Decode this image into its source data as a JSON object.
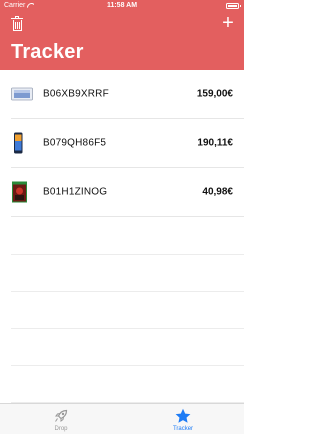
{
  "status_bar": {
    "carrier": "Carrier",
    "time": "11:58 AM"
  },
  "header": {
    "title": "Tracker",
    "add_label": "+"
  },
  "items": [
    {
      "sku": "B06XB9XRRF",
      "price": "159,00€",
      "thumb": "tablet-thumbnail"
    },
    {
      "sku": "B079QH86F5",
      "price": "190,11€",
      "thumb": "phone-thumbnail"
    },
    {
      "sku": "B01H1ZINOG",
      "price": "40,98€",
      "thumb": "game-box-thumbnail"
    }
  ],
  "tabs": [
    {
      "label": "Drop",
      "icon": "rocket-icon",
      "active": false
    },
    {
      "label": "Tracker",
      "icon": "star-icon",
      "active": true
    }
  ],
  "colors": {
    "header": "#e35f5f",
    "tab_active": "#1e7cf5",
    "tab_inactive": "#999999"
  }
}
